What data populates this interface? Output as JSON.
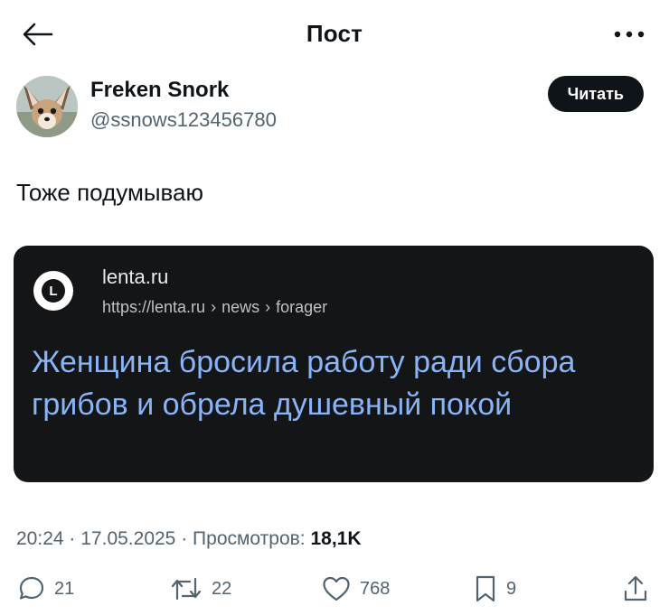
{
  "header": {
    "title": "Пост",
    "back_icon": "arrow-left-icon",
    "more_icon": "more-horizontal-icon"
  },
  "author": {
    "name": "Freken Snork",
    "handle": "@ssnows123456780",
    "follow_label": "Читать",
    "avatar_icon": "fox-avatar"
  },
  "post": {
    "text": "Тоже подумываю"
  },
  "media": {
    "logo_letter": "L",
    "site_name": "lenta.ru",
    "url_parts": [
      "https://lenta.ru",
      "news",
      "forager"
    ],
    "url_separator": "›",
    "headline": "Женщина бросила работу ради сбора грибов и обрела душевный покой",
    "colors": {
      "background": "#141516",
      "headline": "#8ab4f8"
    }
  },
  "meta": {
    "time": "20:24",
    "date": "17.05.2025",
    "views_label": "Просмотров:",
    "views_value": "18,1K",
    "separator": "·"
  },
  "actions": {
    "replies": "21",
    "reposts": "22",
    "likes": "768",
    "bookmarks": "9"
  },
  "colors": {
    "text": "#0f1419",
    "secondary": "#536471",
    "button": "#0f1419"
  }
}
